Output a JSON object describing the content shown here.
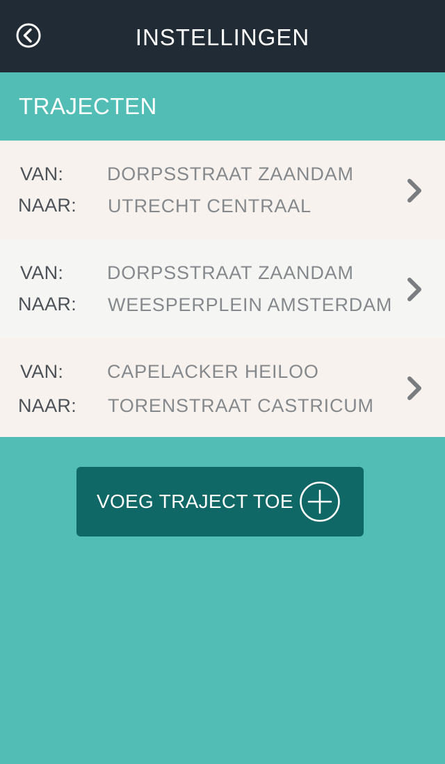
{
  "header": {
    "title": "INSTELLINGEN",
    "back_icon": "back-circle-icon"
  },
  "section": {
    "title": "TRAJECTEN"
  },
  "routes": [
    {
      "from_label": "VAN:",
      "from": "DORPSSTRAAT ZAANDAM",
      "to_label": "NAAR:",
      "to": "UTRECHT CENTRAAL"
    },
    {
      "from_label": "VAN:",
      "from": "DORPSSTRAAT ZAANDAM",
      "to_label": "NAAR:",
      "to": "WEESPERPLEIN AMSTERDAM"
    },
    {
      "from_label": "VAN:",
      "from": "CAPELACKER HEILOO",
      "to_label": "NAAR:",
      "to": "TORENSTRAAT CASTRICUM"
    }
  ],
  "add_button": {
    "label": "VOEG TRAJECT TOE",
    "icon": "plus-circle-icon"
  },
  "colors": {
    "header_bg": "#212b35",
    "accent": "#52bdb5",
    "button_bg": "#106866",
    "row_bg_a": "#f7f2ee",
    "row_bg_b": "#f5f5f4"
  }
}
